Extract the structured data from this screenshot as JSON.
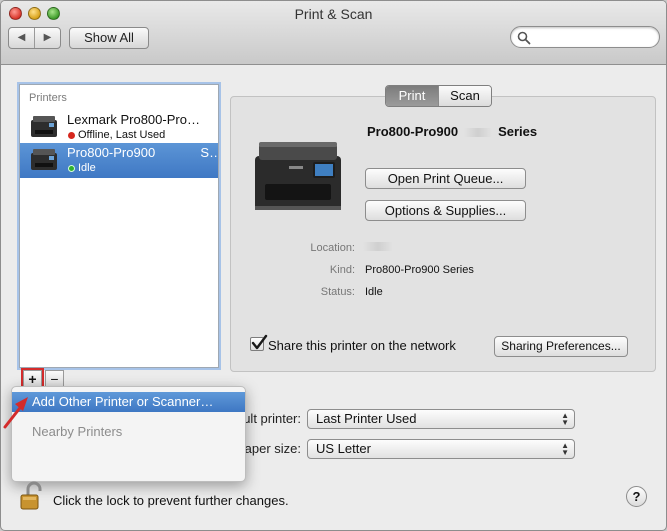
{
  "window": {
    "title": "Print & Scan"
  },
  "toolbar": {
    "back_glyph": "◀",
    "forward_glyph": "▶",
    "show_all_label": "Show All",
    "search_value": ""
  },
  "printers": {
    "header": "Printers",
    "items": [
      {
        "name": "Lexmark Pro800-Pro…",
        "status": "Offline, Last Used",
        "status_color": "#d6281e",
        "selected": false
      },
      {
        "name": "Pro800-Pro900",
        "name_suffix": "S…",
        "status": "Idle",
        "status_color": "#2fb12f",
        "selected": true
      }
    ],
    "add_glyph": "+",
    "remove_glyph": "−"
  },
  "add_menu": {
    "items": [
      {
        "label": "Add Other Printer or Scanner…",
        "highlighted": true
      },
      {
        "label": "Nearby Printers",
        "enabled": false
      }
    ]
  },
  "detail": {
    "tabs": [
      {
        "label": "Print",
        "selected": true
      },
      {
        "label": "Scan",
        "selected": false
      }
    ],
    "printer_name": "Pro800-Pro900",
    "printer_name_suffix": "Series",
    "open_queue_label": "Open Print Queue...",
    "options_label": "Options & Supplies...",
    "info": [
      {
        "label": "Location:",
        "value": ""
      },
      {
        "label": "Kind:",
        "value": "Pro800-Pro900 Series"
      },
      {
        "label": "Status:",
        "value": "Idle"
      }
    ],
    "share_label": "Share this printer on the network",
    "share_checked": true,
    "sharing_prefs_label": "Sharing Preferences..."
  },
  "defaults": {
    "default_printer_label": "Default printer:",
    "default_printer_value": "Last Printer Used",
    "paper_size_label": "Default paper size:",
    "paper_size_value": "US Letter"
  },
  "footer": {
    "lock_text": "Click the lock to prevent further changes.",
    "help_glyph": "?"
  },
  "colors": {
    "selection": "#3f78c4",
    "annotation": "#d42b2b"
  }
}
